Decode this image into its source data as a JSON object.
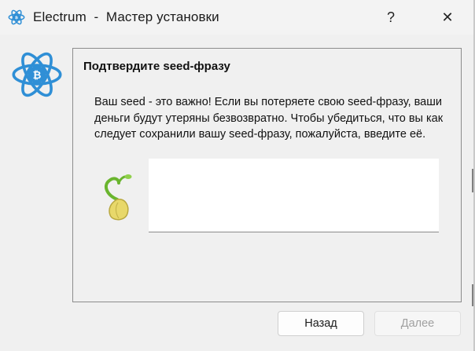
{
  "window": {
    "title": "Electrum  -  Мастер установки",
    "help_label": "?",
    "close_label": "✕"
  },
  "page": {
    "heading": "Подтвердите seed-фразу",
    "message": "Ваш seed - это важно! Если вы потеряете свою seed-фразу, ваши деньги будут утеряны безвозвратно. Чтобы убедиться, что вы как следует сохранили вашу seed-фразу, пожалуйста, введите её.",
    "seed_input_value": ""
  },
  "buttons": {
    "back_label": "Назад",
    "next_label": "Далее"
  },
  "icons": {
    "title": "electrum-logo-icon",
    "logo": "electrum-logo-icon",
    "seed": "seed-sprout-icon"
  },
  "colors": {
    "electrum_blue": "#2f8fd6",
    "seed_yellow": "#e8d86a",
    "sprout_green": "#7cc63a",
    "disabled_text": "#a0a0a0"
  }
}
